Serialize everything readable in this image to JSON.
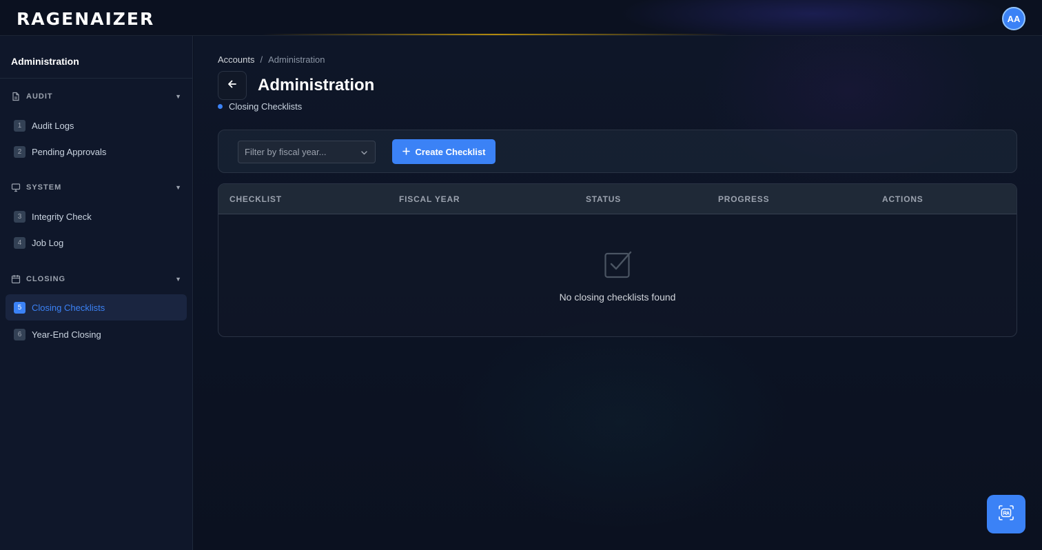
{
  "app": {
    "logo_text": "RAGENAIZER",
    "avatar_initials": "AA"
  },
  "sidebar": {
    "title": "Administration",
    "sections": [
      {
        "label": "AUDIT",
        "icon": "document-icon",
        "items": [
          {
            "num": "1",
            "label": "Audit Logs"
          },
          {
            "num": "2",
            "label": "Pending Approvals"
          }
        ]
      },
      {
        "label": "SYSTEM",
        "icon": "monitor-icon",
        "items": [
          {
            "num": "3",
            "label": "Integrity Check"
          },
          {
            "num": "4",
            "label": "Job Log"
          }
        ]
      },
      {
        "label": "CLOSING",
        "icon": "calendar-icon",
        "items": [
          {
            "num": "5",
            "label": "Closing Checklists",
            "active": true
          },
          {
            "num": "6",
            "label": "Year-End Closing"
          }
        ]
      }
    ]
  },
  "breadcrumb": {
    "root": "Accounts",
    "separator": "/",
    "current": "Administration"
  },
  "header": {
    "title": "Administration",
    "subtitle": "Closing Checklists"
  },
  "toolbar": {
    "filter_placeholder": "Filter by fiscal year...",
    "create_label": "Create Checklist"
  },
  "table": {
    "columns": [
      "CHECKLIST",
      "FISCAL YEAR",
      "STATUS",
      "PROGRESS",
      "ACTIONS"
    ],
    "rows": [],
    "empty_message": "No closing checklists found"
  },
  "colors": {
    "accent": "#3b82f6",
    "background": "#0b1120",
    "sidebar": "#0f172a"
  }
}
